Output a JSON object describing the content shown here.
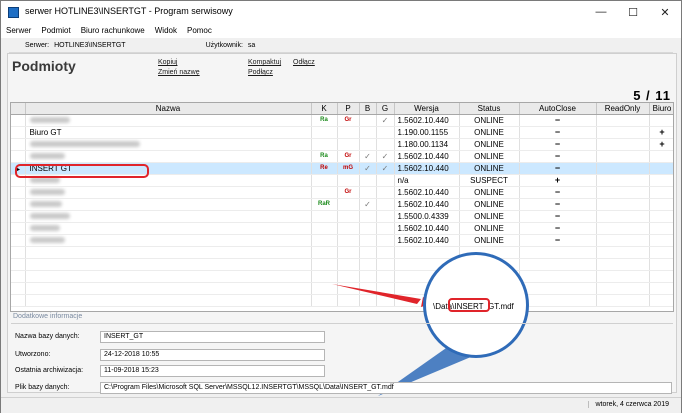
{
  "window": {
    "title": "serwer HOTLINE3\\INSERTGT - Program serwisowy"
  },
  "menu": [
    "Serwer",
    "Podmiot",
    "Biuro rachunkowe",
    "Widok",
    "Pomoc"
  ],
  "topbar": {
    "server_label": "Serwer:",
    "server_value": "HOTLINE3\\INSERTGT",
    "user_label": "Użytkownik:",
    "user_value": "sa"
  },
  "header": {
    "title": "Podmioty",
    "links": [
      "Kopiuj",
      "Zmień nazwę",
      "Kompaktuj",
      "Podłącz",
      "Odłącz"
    ],
    "counter": "5 / 11"
  },
  "table": {
    "columns": [
      "Nazwa",
      "K",
      "P",
      "B",
      "G",
      "Wersja",
      "Status",
      "AutoClose",
      "ReadOnly",
      "Biuro"
    ],
    "rows": [
      {
        "name": "",
        "k": "Ra",
        "p": "Gr",
        "b": "",
        "g": "✓",
        "version": "1.5602.10.440",
        "status": "ONLINE",
        "autoclose": "−",
        "readonly": "",
        "biuro": ""
      },
      {
        "name": "Biuro GT",
        "k": "",
        "p": "",
        "b": "",
        "g": "",
        "version": "1.190.00.1155",
        "status": "ONLINE",
        "autoclose": "−",
        "readonly": "",
        "biuro": "+"
      },
      {
        "name": "",
        "k": "",
        "p": "",
        "b": "",
        "g": "",
        "version": "1.180.00.1134",
        "status": "ONLINE",
        "autoclose": "−",
        "readonly": "",
        "biuro": "+"
      },
      {
        "name": "",
        "k": "Ra",
        "p": "Gr",
        "b": "✓",
        "g": "✓",
        "version": "1.5602.10.440",
        "status": "ONLINE",
        "autoclose": "−",
        "readonly": "",
        "biuro": ""
      },
      {
        "name": "INSERT GT",
        "k": "Re",
        "p": "mG",
        "b": "✓",
        "g": "✓",
        "version": "1.5602.10.440",
        "status": "ONLINE",
        "autoclose": "−",
        "readonly": "",
        "biuro": ""
      },
      {
        "name": "",
        "k": "",
        "p": "",
        "b": "",
        "g": "",
        "version": "n/a",
        "status": "SUSPECT",
        "autoclose": "+",
        "readonly": "",
        "biuro": ""
      },
      {
        "name": "",
        "k": "",
        "p": "Gr",
        "b": "",
        "g": "",
        "version": "1.5602.10.440",
        "status": "ONLINE",
        "autoclose": "−",
        "readonly": "",
        "biuro": ""
      },
      {
        "name": "",
        "k": "RaR",
        "p": "",
        "b": "✓",
        "g": "",
        "version": "1.5602.10.440",
        "status": "ONLINE",
        "autoclose": "−",
        "readonly": "",
        "biuro": ""
      },
      {
        "name": "",
        "k": "",
        "p": "",
        "b": "",
        "g": "",
        "version": "1.5500.0.4339",
        "status": "ONLINE",
        "autoclose": "−",
        "readonly": "",
        "biuro": ""
      },
      {
        "name": "",
        "k": "",
        "p": "",
        "b": "",
        "g": "",
        "version": "1.5602.10.440",
        "status": "ONLINE",
        "autoclose": "−",
        "readonly": "",
        "biuro": ""
      },
      {
        "name": "",
        "k": "",
        "p": "",
        "b": "",
        "g": "",
        "version": "1.5602.10.440",
        "status": "ONLINE",
        "autoclose": "−",
        "readonly": "",
        "biuro": ""
      }
    ]
  },
  "magnifier": {
    "prefix": "\\Data\\",
    "highlight": "INSERT_GT",
    "suffix": ".mdf"
  },
  "info": {
    "title": "Dodatkowe informacje",
    "fields": [
      {
        "label": "Nazwa bazy danych:",
        "value": "INSERT_GT"
      },
      {
        "label": "Utworzono:",
        "value": "24-12-2018 10:55"
      },
      {
        "label": "Ostatnia archiwizacja:",
        "value": "11-09-2018 15:23"
      },
      {
        "label": "Plik bazy danych:",
        "value": "C:\\Program Files\\Microsoft SQL Server\\MSSQL12.INSERTGT\\MSSQL\\Data\\INSERT_GT.mdf"
      }
    ]
  },
  "status": {
    "date": "wtorek, 4 czerwca 2019"
  },
  "colors": {
    "selected_row": "#cce8ff",
    "highlight_red": "#e0242a",
    "magnifier_blue": "#2f6bb8",
    "k_tag_green": "#1a8a1a",
    "p_tag_red": "#c00000"
  }
}
